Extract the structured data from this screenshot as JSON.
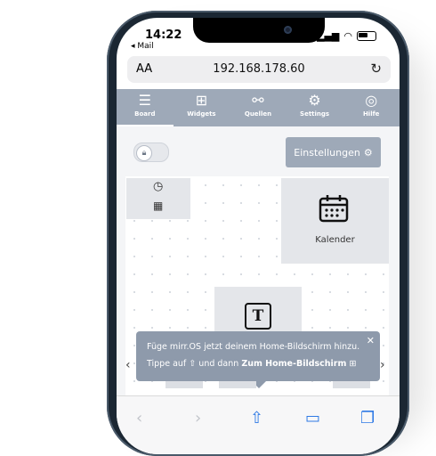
{
  "status": {
    "time": "14:22",
    "back_app": "◂ Mail"
  },
  "browser": {
    "text_size": "AA",
    "url": "192.168.178.60",
    "reload_icon": "reload-icon"
  },
  "nav": {
    "items": [
      {
        "label": "Board",
        "icon": "board-icon"
      },
      {
        "label": "Widgets",
        "icon": "widgets-icon"
      },
      {
        "label": "Quellen",
        "icon": "sources-icon"
      },
      {
        "label": "Settings",
        "icon": "gear-icon"
      },
      {
        "label": "Hilfe",
        "icon": "help-icon"
      }
    ],
    "active": "Board"
  },
  "toolbar": {
    "settings_label": "Einstellungen"
  },
  "widgets": {
    "calendar_label": "Kalender"
  },
  "popup": {
    "line1": "Füge mirr.OS jetzt deinem Home-Bildschirm hinzu.",
    "line2_prefix": "Tippe auf",
    "line2_middle": "und dann",
    "line2_bold": "Zum Home-Bildschirm"
  },
  "colors": {
    "accent": "#9ea9b8",
    "popup": "#8e9aab",
    "ios_blue": "#2f7ae5"
  }
}
